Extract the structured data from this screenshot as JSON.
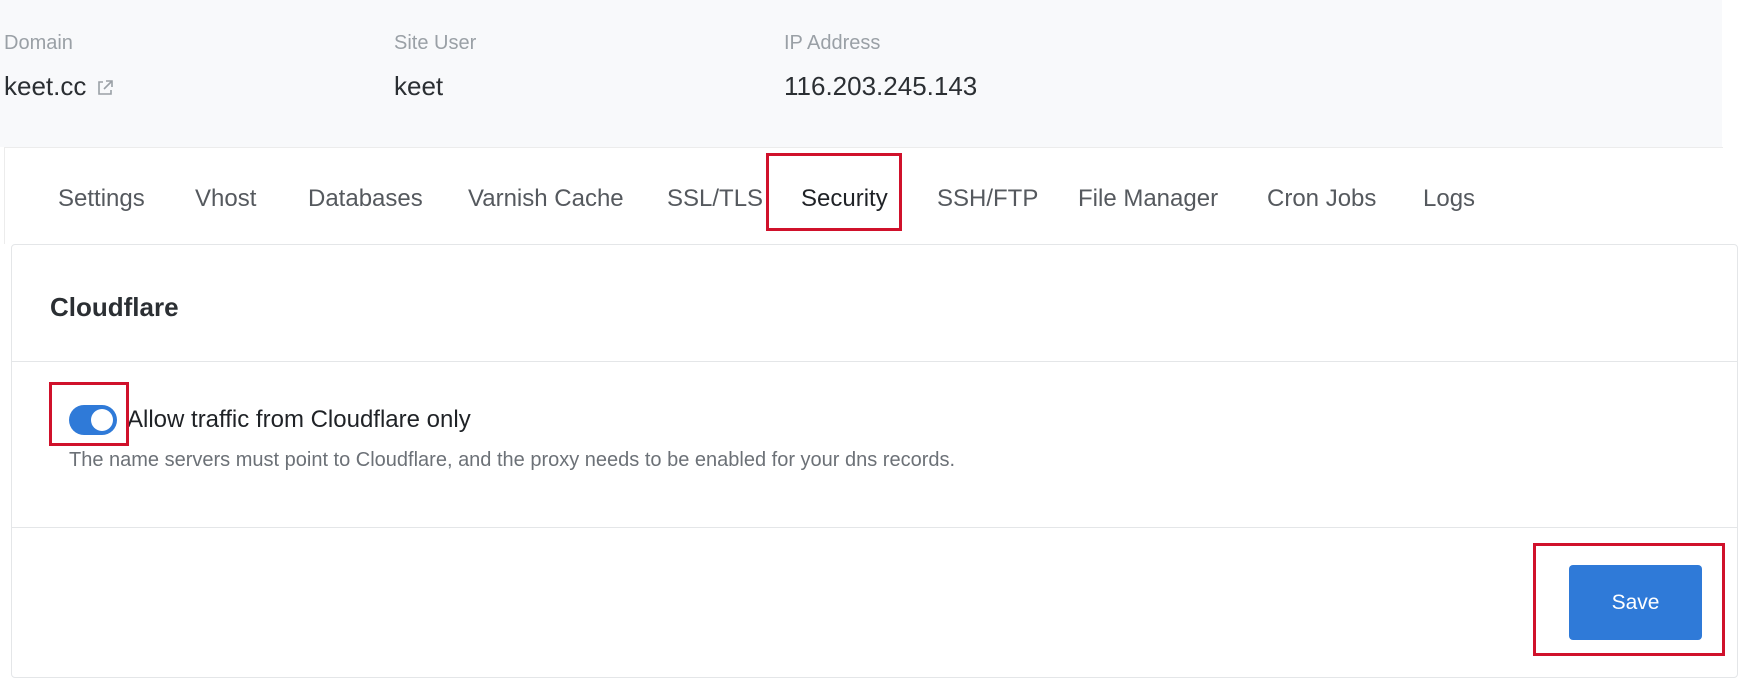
{
  "site_info": {
    "domain": {
      "label": "Domain",
      "value": "keet.cc",
      "icon": "external-link-icon"
    },
    "site_user": {
      "label": "Site User",
      "value": "keet"
    },
    "ip_address": {
      "label": "IP Address",
      "value": "116.203.245.143"
    }
  },
  "tabs": [
    {
      "label": "Settings"
    },
    {
      "label": "Vhost"
    },
    {
      "label": "Databases"
    },
    {
      "label": "Varnish Cache"
    },
    {
      "label": "SSL/TLS"
    },
    {
      "label": "Security",
      "active": true
    },
    {
      "label": "SSH/FTP"
    },
    {
      "label": "File Manager"
    },
    {
      "label": "Cron Jobs"
    },
    {
      "label": "Logs"
    }
  ],
  "cloudflare": {
    "title": "Cloudflare",
    "toggle": {
      "label": "Allow traffic from Cloudflare only",
      "enabled": true
    },
    "help": "The name servers must point to Cloudflare, and the proxy needs to be enabled for your dns records."
  },
  "footer": {
    "save_label": "Save"
  },
  "colors": {
    "accent": "#2f7ad8",
    "highlight": "#d0112b"
  }
}
